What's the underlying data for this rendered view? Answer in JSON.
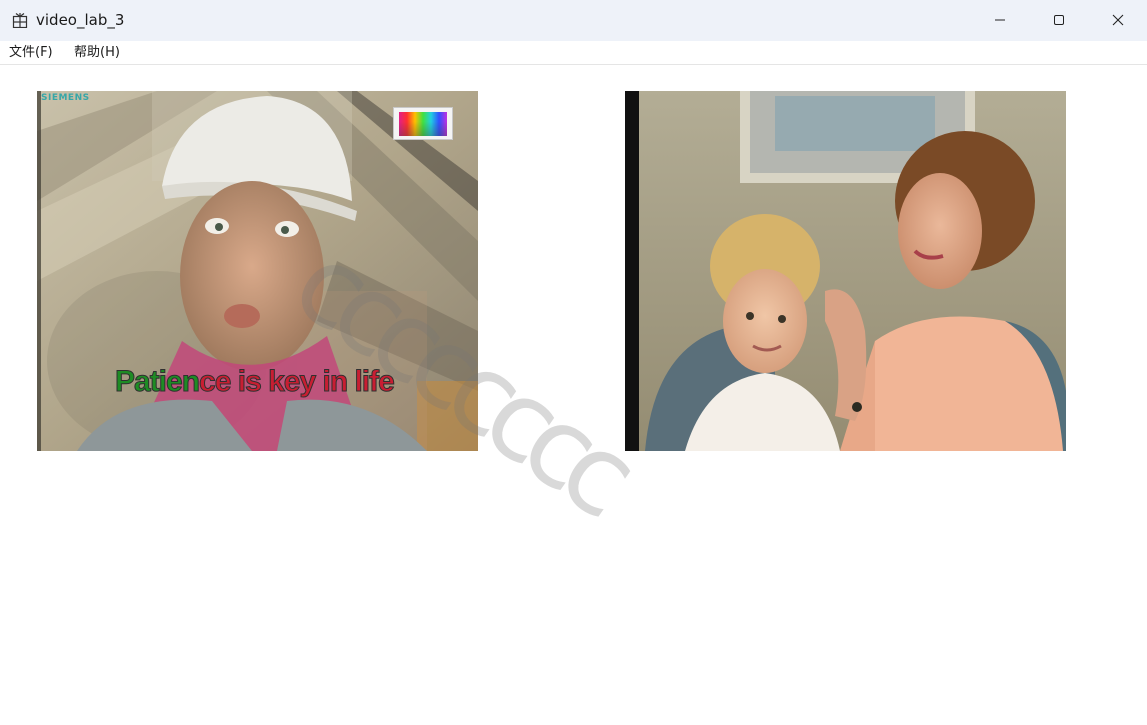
{
  "window": {
    "title": "video_lab_3",
    "icons": {
      "app": "app-grid-icon",
      "minimize": "minimize-icon",
      "maximize": "maximize-icon",
      "close": "close-icon"
    }
  },
  "menu": {
    "file": "文件(F)",
    "help": "帮助(H)"
  },
  "left_video": {
    "logo": "SIEMENS",
    "subtitle_green": "Patien",
    "subtitle_red": "ce is key in life",
    "colors": {
      "subtitle_green": "#1e8c24",
      "subtitle_red": "#c81e32",
      "logo": "#36a7a8"
    }
  },
  "overlay": {
    "watermark": "cccccccc"
  }
}
